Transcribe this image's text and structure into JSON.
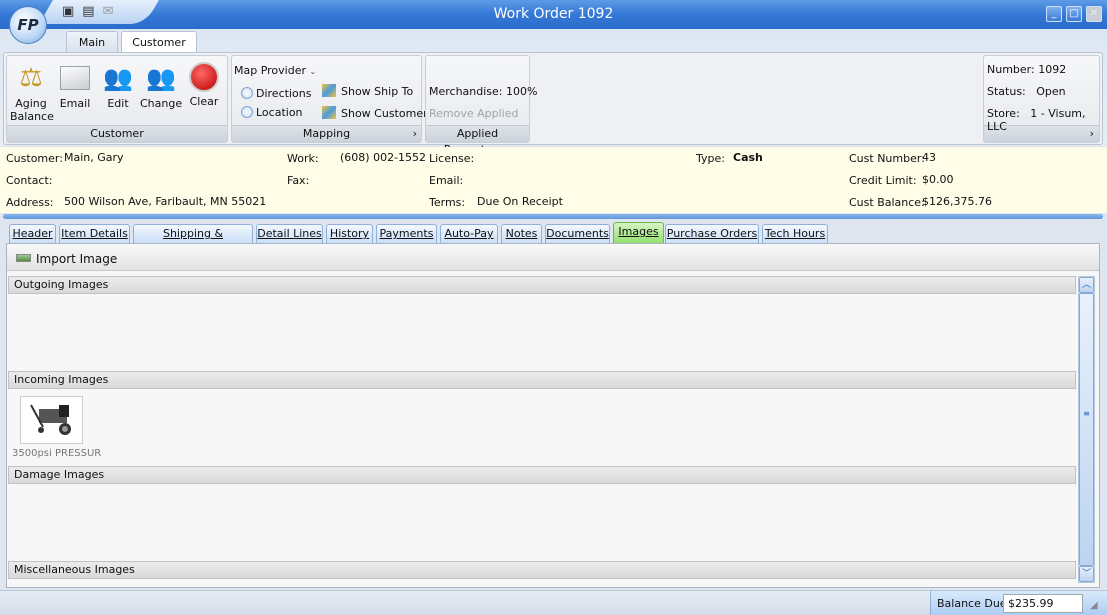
{
  "window": {
    "title": "Work Order 1092",
    "logo_text": "FP"
  },
  "quick_access": [
    "save-icon",
    "save-all-icon",
    "email-icon"
  ],
  "ribbon_tabs": [
    {
      "label": "Main"
    },
    {
      "label": "Customer",
      "active": true
    }
  ],
  "ribbon": {
    "customer_group": {
      "label": "Customer",
      "buttons": [
        {
          "label": "Aging Balance",
          "icon": "scales-icon"
        },
        {
          "label": "Email",
          "icon": "envelope-icon"
        },
        {
          "label": "Edit",
          "icon": "people-icon"
        },
        {
          "label": "Change",
          "icon": "people-change-icon"
        },
        {
          "label": "Clear",
          "icon": "no-entry-icon"
        }
      ]
    },
    "mapping_group": {
      "label": "Mapping",
      "map_provider": "Map Provider",
      "directions": "Directions",
      "location": "Location",
      "show_ship_to": "Show Ship To",
      "show_customer": "Show Customer"
    },
    "applied_group": {
      "label": "Applied Percentages",
      "merchandise": "Merchandise: 100%",
      "remove_applied": "Remove Applied"
    },
    "summary": {
      "number_label": "Number:",
      "number": "1092",
      "status_label": "Status:",
      "status": "Open",
      "store_label": "Store:",
      "store": "1 - Visum, LLC"
    }
  },
  "info": {
    "customer_label": "Customer:",
    "customer": "Main, Gary",
    "contact_label": "Contact:",
    "contact": "",
    "address_label": "Address:",
    "address": "500 Wilson Ave, Faribault, MN 55021",
    "work_label": "Work:",
    "work": "(608) 002-1552",
    "fax_label": "Fax:",
    "fax": "",
    "license_label": "License:",
    "license": "",
    "email_label": "Email:",
    "email": "",
    "terms_label": "Terms:",
    "terms": "Due On Receipt",
    "type_label": "Type:",
    "type": "Cash",
    "cust_number_label": "Cust Number:",
    "cust_number": "43",
    "credit_limit_label": "Credit Limit:",
    "credit_limit": "$0.00",
    "cust_balance_label": "Cust Balance:",
    "cust_balance": "$126,375.76"
  },
  "tabs": [
    {
      "label": "Header"
    },
    {
      "label": "Item Details"
    },
    {
      "label": "Shipping & Dispatching"
    },
    {
      "label": "Detail Lines"
    },
    {
      "label": "History"
    },
    {
      "label": "Payments"
    },
    {
      "label": "Auto-Pay"
    },
    {
      "label": "Notes"
    },
    {
      "label": "Documents"
    },
    {
      "label": "Images",
      "active": true
    },
    {
      "label": "Purchase Orders"
    },
    {
      "label": "Tech Hours"
    }
  ],
  "images": {
    "import_label": "Import Image",
    "sections": [
      "Outgoing Images",
      "Incoming Images",
      "Damage Images",
      "Miscellaneous Images"
    ],
    "incoming": [
      {
        "caption": "3500psi PRESSUR"
      }
    ]
  },
  "status": {
    "balance_due_label": "Balance Due:",
    "balance_due": "$235.99"
  }
}
